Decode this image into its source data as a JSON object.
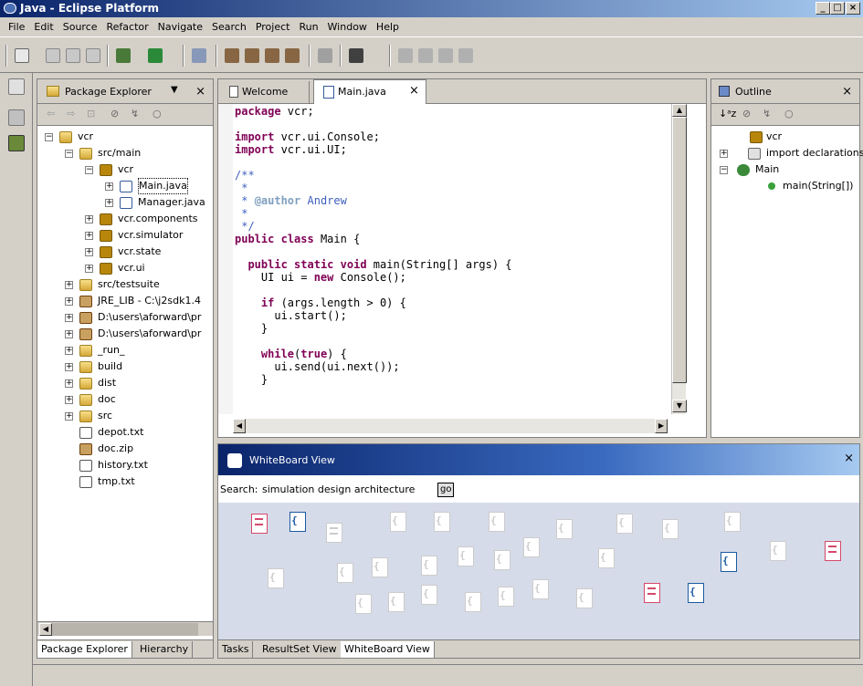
{
  "window": {
    "title": "Java - Eclipse Platform"
  },
  "menubar": [
    "File",
    "Edit",
    "Source",
    "Refactor",
    "Navigate",
    "Search",
    "Project",
    "Run",
    "Window",
    "Help"
  ],
  "package_explorer": {
    "title": "Package Explorer",
    "tree": [
      {
        "label": "vcr",
        "icon": "project-icon"
      },
      {
        "label": "src/main",
        "icon": "source-folder-icon"
      },
      {
        "label": "vcr",
        "icon": "package-icon"
      },
      {
        "label": "Main.java",
        "icon": "java-file-icon"
      },
      {
        "label": "Manager.java",
        "icon": "java-file-icon"
      },
      {
        "label": "vcr.components",
        "icon": "package-icon"
      },
      {
        "label": "vcr.simulator",
        "icon": "package-icon"
      },
      {
        "label": "vcr.state",
        "icon": "package-icon"
      },
      {
        "label": "vcr.ui",
        "icon": "package-icon"
      },
      {
        "label": "src/testsuite",
        "icon": "source-folder-icon"
      },
      {
        "label": "JRE_LIB - C:\\j2sdk1.4",
        "icon": "library-icon"
      },
      {
        "label": "D:\\users\\aforward\\pr",
        "icon": "library-icon"
      },
      {
        "label": "D:\\users\\aforward\\pr",
        "icon": "library-icon"
      },
      {
        "label": "_run_",
        "icon": "folder-icon"
      },
      {
        "label": "build",
        "icon": "folder-icon"
      },
      {
        "label": "dist",
        "icon": "folder-icon"
      },
      {
        "label": "doc",
        "icon": "folder-icon"
      },
      {
        "label": "src",
        "icon": "folder-icon"
      },
      {
        "label": "depot.txt",
        "icon": "text-file-icon"
      },
      {
        "label": "doc.zip",
        "icon": "zip-file-icon"
      },
      {
        "label": "history.txt",
        "icon": "text-file-icon"
      },
      {
        "label": "tmp.txt",
        "icon": "text-file-icon"
      }
    ],
    "bottom_tabs": [
      "Package Explorer",
      "Hierarchy"
    ]
  },
  "editor": {
    "tabs": [
      "Welcome",
      "Main.java"
    ],
    "code_lines": [
      "package vcr;",
      "",
      "import vcr.ui.Console;",
      "import vcr.ui.UI;",
      "",
      "/**",
      " *",
      " * @author Andrew",
      " *",
      " */",
      "public class Main {",
      "",
      "  public static void main(String[] args) {",
      "    UI ui = new Console();",
      "",
      "    if (args.length > 0) {",
      "      ui.start();",
      "    }",
      "",
      "    while(true) {",
      "      ui.send(ui.next());",
      "    }"
    ]
  },
  "outline": {
    "title": "Outline",
    "items": [
      "vcr",
      "import declarations",
      "Main",
      "main(String[])"
    ]
  },
  "whiteboard": {
    "title": "WhiteBoard View",
    "search_label": "Search:",
    "search_value": "simulation design architecture",
    "go_label": "go",
    "bottom_tabs": [
      "Tasks",
      "ResultSet View",
      "WhiteBoard View"
    ]
  },
  "colors": {
    "title_start": "#0a246a",
    "title_end": "#a6caf0",
    "keyword": "#7f0055",
    "comment": "#3f5fbf",
    "whiteboard_bg": "#d6dbe9"
  }
}
